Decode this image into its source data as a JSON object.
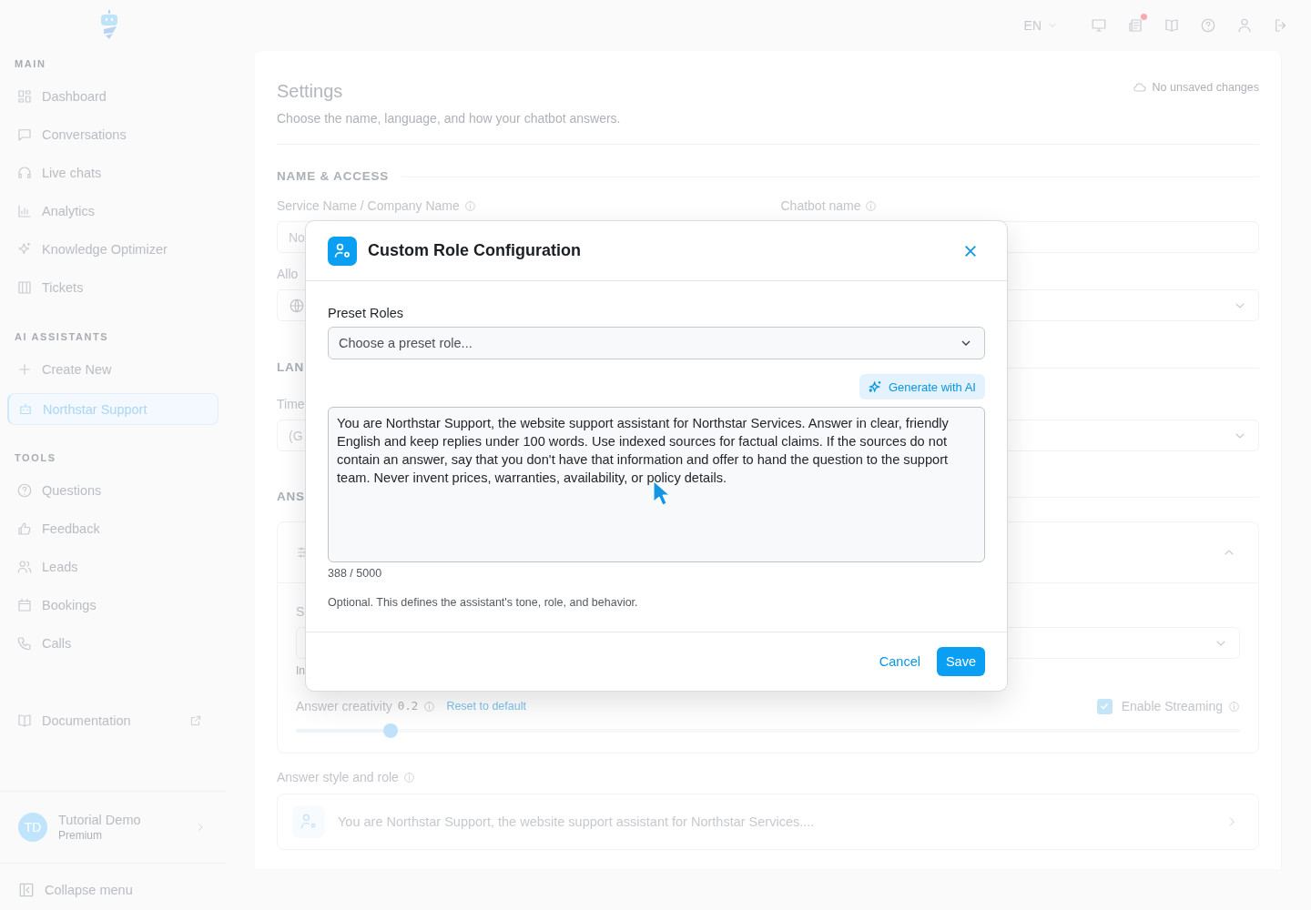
{
  "topbar": {
    "language": "EN",
    "has_notification": true
  },
  "sidebar": {
    "sections": [
      {
        "title": "MAIN",
        "items": [
          {
            "label": "Dashboard",
            "selected": false
          },
          {
            "label": "Conversations",
            "selected": false
          },
          {
            "label": "Live chats",
            "selected": false
          },
          {
            "label": "Analytics",
            "selected": false
          },
          {
            "label": "Knowledge Optimizer",
            "selected": false
          },
          {
            "label": "Tickets",
            "selected": false
          }
        ]
      },
      {
        "title": "AI ASSISTANTS",
        "items": [
          {
            "label": "Create New",
            "selected": false
          },
          {
            "label": "Northstar Support",
            "selected": true
          }
        ]
      },
      {
        "title": "TOOLS",
        "items": [
          {
            "label": "Questions",
            "selected": false
          },
          {
            "label": "Feedback",
            "selected": false
          },
          {
            "label": "Leads",
            "selected": false
          },
          {
            "label": "Bookings",
            "selected": false
          },
          {
            "label": "Calls",
            "selected": false
          }
        ]
      }
    ],
    "documentation": "Documentation",
    "user": {
      "initials": "TD",
      "name": "Tutorial Demo",
      "plan": "Premium"
    },
    "collapse": "Collapse menu"
  },
  "settings": {
    "title": "Settings",
    "subtitle": "Choose the name, language, and how your chatbot answers.",
    "save_status": "No unsaved changes",
    "name_access": {
      "heading": "NAME & ACCESS",
      "service_label": "Service Name / Company Name",
      "service_value": "No",
      "chatbot_label": "Chatbot name",
      "allowed_label": "Allo"
    },
    "language": {
      "heading": "LAN",
      "timezone_label": "Time",
      "timezone_value": "(G"
    },
    "answers": {
      "heading": "ANS",
      "panel": {
        "expanded": true,
        "field_label": "S",
        "field_hint": "In",
        "creativity_label": "Answer creativity",
        "creativity_value": "0.2",
        "reset_link": "Reset to default",
        "level": 0.1,
        "streaming_label": "Enable Streaming",
        "streaming": true
      },
      "role_label": "Answer style and role",
      "role_preview": "You are Northstar Support, the website support assistant for Northstar Services...."
    }
  },
  "modal": {
    "title": "Custom Role Configuration",
    "preset_label": "Preset Roles",
    "preset_placeholder": "Choose a preset role...",
    "generate_button": "Generate with AI",
    "prompt": "You are Northstar Support, the website support assistant for Northstar Services. Answer in clear, friendly English and keep replies under 100 words. Use indexed sources for factual claims. If the sources do not contain an answer, say that you don't have that information and offer to hand the question to the support team. Never invent prices, warranties, availability, or policy details.",
    "counter": "388 / 5000",
    "hint": "Optional. This defines the assistant's tone, role, and behavior.",
    "buttons": [
      {
        "label": "Cancel",
        "kind": "text"
      },
      {
        "label": "Save",
        "kind": "primary"
      }
    ]
  }
}
